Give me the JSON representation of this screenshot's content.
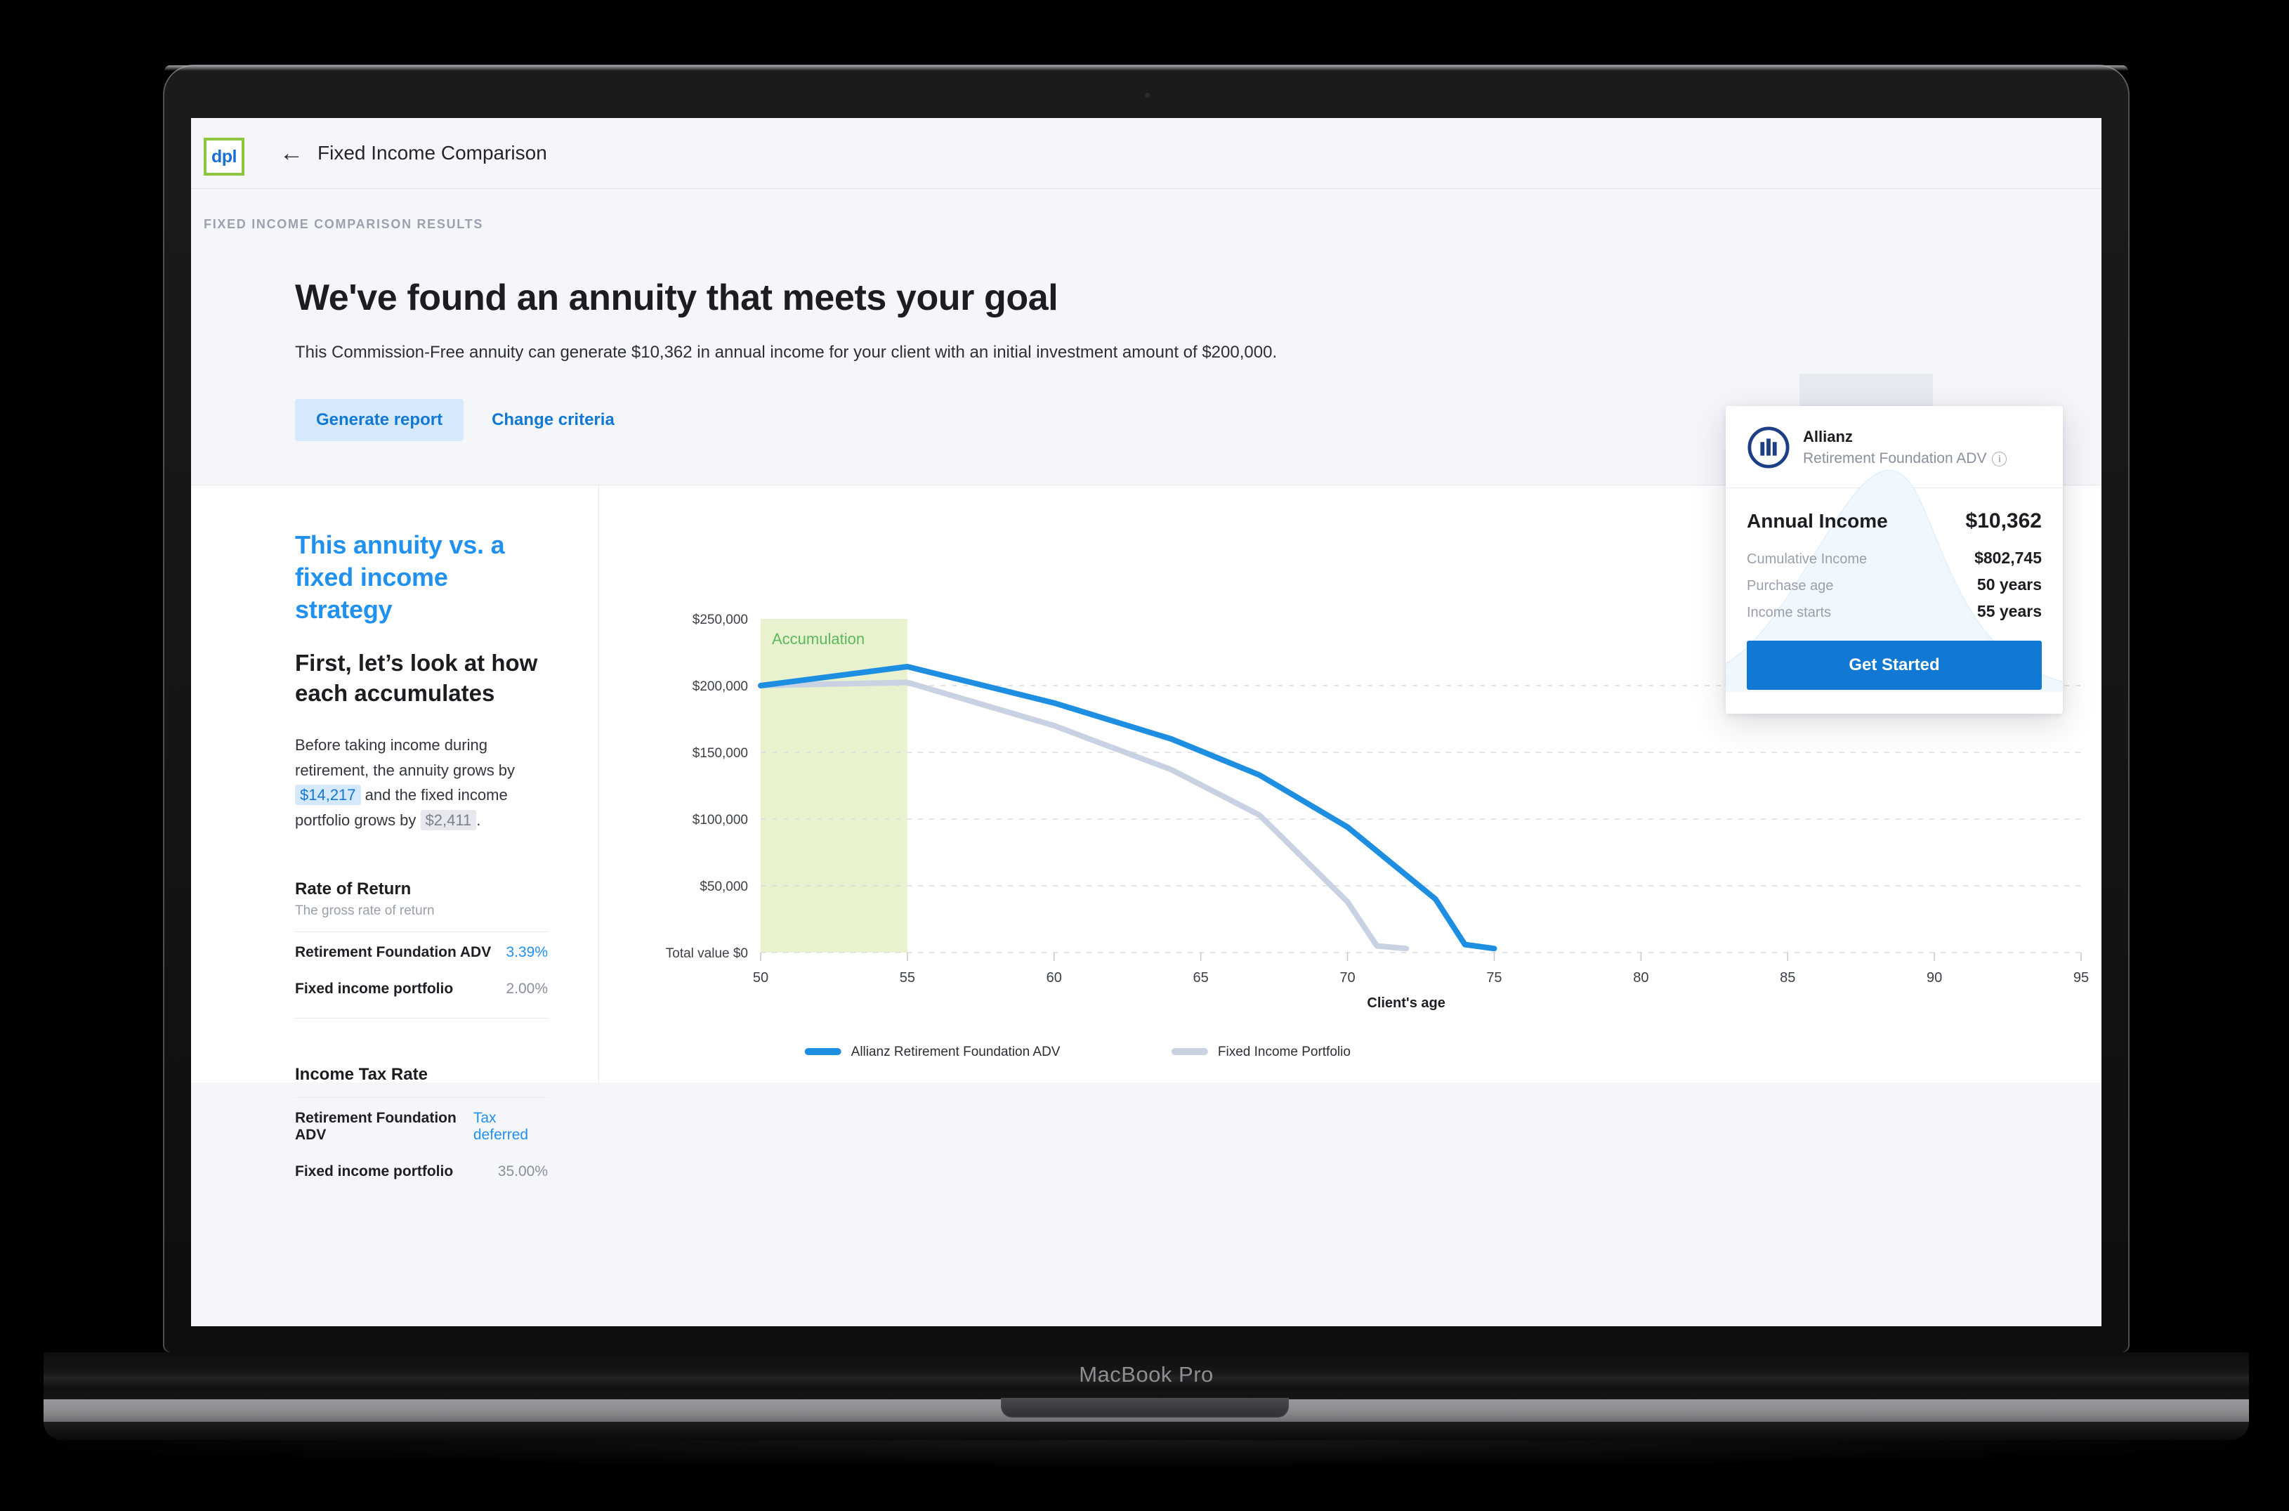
{
  "device": {
    "model_label": "MacBook Pro"
  },
  "topbar": {
    "logo_text": "dpl",
    "back_icon": "←",
    "breadcrumb_title": "Fixed Income Comparison"
  },
  "page": {
    "section_label": "FIXED INCOME COMPARISON RESULTS",
    "headline": "We've found an annuity that meets your goal",
    "subhead": "This Commission-Free annuity can generate $10,362 in annual income for your client with an initial investment amount of $200,000.",
    "primary_action": "Generate report",
    "secondary_action": "Change criteria"
  },
  "left_panel": {
    "eyebrow": "This annuity vs. a fixed income strategy",
    "subtitle": "First, let’s look at how each accumulates",
    "blurb": {
      "part1": "Before taking income during retirement, the annuity grows by",
      "annuity_growth": "$14,217",
      "part2": "and the fixed income portfolio grows by",
      "portfolio_growth": "$2,411",
      "part3": "."
    },
    "rate_of_return": {
      "title": "Rate of Return",
      "subtitle": "The gross rate of return",
      "rows": [
        {
          "label": "Retirement Foundation ADV",
          "value": "3.39%",
          "accent": true
        },
        {
          "label": "Fixed income portfolio",
          "value": "2.00%",
          "accent": false
        }
      ]
    },
    "income_tax_rate": {
      "title": "Income Tax Rate",
      "rows": [
        {
          "label": "Retirement Foundation ADV",
          "value": "Tax deferred",
          "accent": true
        },
        {
          "label": "Fixed income portfolio",
          "value": "35.00%",
          "accent": false
        }
      ]
    }
  },
  "product_card": {
    "carrier": "Allianz",
    "product": "Retirement Foundation ADV",
    "info_icon": "i",
    "rows": [
      {
        "label": "Annual Income",
        "value": "$10,362",
        "primary": true
      },
      {
        "label": "Cumulative Income",
        "value": "$802,745",
        "primary": false
      },
      {
        "label": "Purchase age",
        "value": "50 years",
        "primary": false
      },
      {
        "label": "Income starts",
        "value": "55 years",
        "primary": false
      }
    ],
    "cta": "Get Started"
  },
  "colors": {
    "annuity_blue": "#1e8fe0",
    "portfolio_gray": "#c9d2e2",
    "accumulation_fill": "#e9f2cf",
    "accumulation_text": "#5cb85c",
    "brand_blue": "#1178d4",
    "brand_green": "#8cc63f",
    "page_bg": "#f4f6f9"
  },
  "chart_data": {
    "type": "line",
    "title": "",
    "xlabel": "Client's age",
    "ylabel": "Total value",
    "x_ticks": [
      50,
      55,
      60,
      65,
      70,
      75,
      80,
      85,
      90,
      95
    ],
    "y_ticks": [
      0,
      50000,
      100000,
      150000,
      200000,
      250000
    ],
    "y_tick_labels": [
      "Total value $0",
      "$50,000",
      "$100,000",
      "$150,000",
      "$200,000",
      "$250,000"
    ],
    "xlim": [
      50,
      95
    ],
    "ylim": [
      0,
      250000
    ],
    "grid": true,
    "legend_position": "bottom",
    "annotations": [
      {
        "text": "Accumulation",
        "x_start": 50,
        "x_end": 55,
        "fill": "#e9f2cf",
        "text_color": "#5cb85c"
      }
    ],
    "x": [
      50,
      55,
      60,
      65,
      70,
      75,
      80,
      85,
      90,
      95
    ],
    "series": [
      {
        "name": "Allianz Retirement Foundation ADV",
        "color": "#1e8fe0",
        "x": [
          50,
          55,
          60,
          64,
          67,
          70,
          73,
          74,
          75
        ],
        "values": [
          200000,
          214217,
          187000,
          160000,
          133000,
          94000,
          40000,
          6000,
          3000
        ]
      },
      {
        "name": "Fixed Income Portfolio",
        "color": "#c9d2e2",
        "x": [
          50,
          55,
          60,
          64,
          67,
          70,
          71,
          72
        ],
        "values": [
          200000,
          202411,
          170000,
          137000,
          103000,
          38000,
          5000,
          3000
        ]
      }
    ]
  }
}
